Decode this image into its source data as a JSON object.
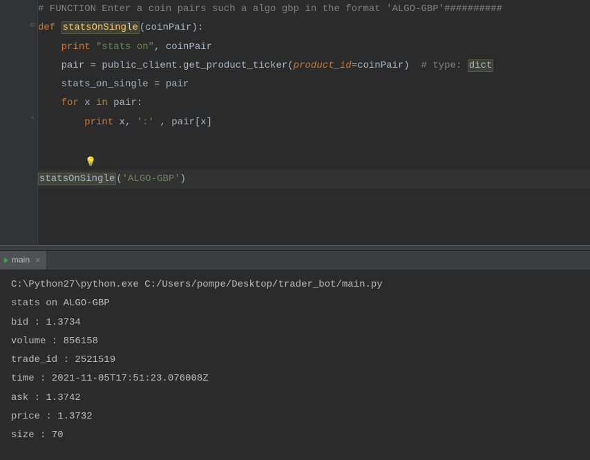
{
  "editor": {
    "lines": {
      "comment_line": "# FUNCTION Enter a coin pairs such a algo gbp in the format 'ALGO-GBP'##########",
      "def_kw": "def",
      "func_name": "statsOnSingle",
      "def_params": "(coinPair):",
      "print1_kw": "print",
      "print1_str": " \"stats on\"",
      "print1_rest": ", coinPair",
      "assign1_a": "pair = public_client.get_product_ticker(",
      "assign1_kwarg": "product_id",
      "assign1_b": "=coinPair)  ",
      "assign1_comment": "# type: ",
      "assign1_hint": "dict",
      "assign2": "stats_on_single = pair",
      "for_kw": "for",
      "for_var": " x ",
      "in_kw": "in",
      "for_rest": " pair:",
      "print2_kw": "print",
      "print2_mid": " x, ",
      "print2_str": "':'",
      "print2_end": " , pair[x]",
      "call_name": "statsOnSingle",
      "call_paren1": "(",
      "call_arg": "'ALGO-GBP'",
      "call_paren2": ")"
    },
    "indent1": "    ",
    "indent2": "        "
  },
  "bulb": "💡",
  "terminal": {
    "tab_label": "main",
    "output": [
      "C:\\Python27\\python.exe C:/Users/pompe/Desktop/trader_bot/main.py",
      "stats on ALGO-GBP",
      "bid : 1.3734",
      "volume : 856158",
      "trade_id : 2521519",
      "time : 2021-11-05T17:51:23.076008Z",
      "ask : 1.3742",
      "price : 1.3732",
      "size : 70"
    ]
  }
}
